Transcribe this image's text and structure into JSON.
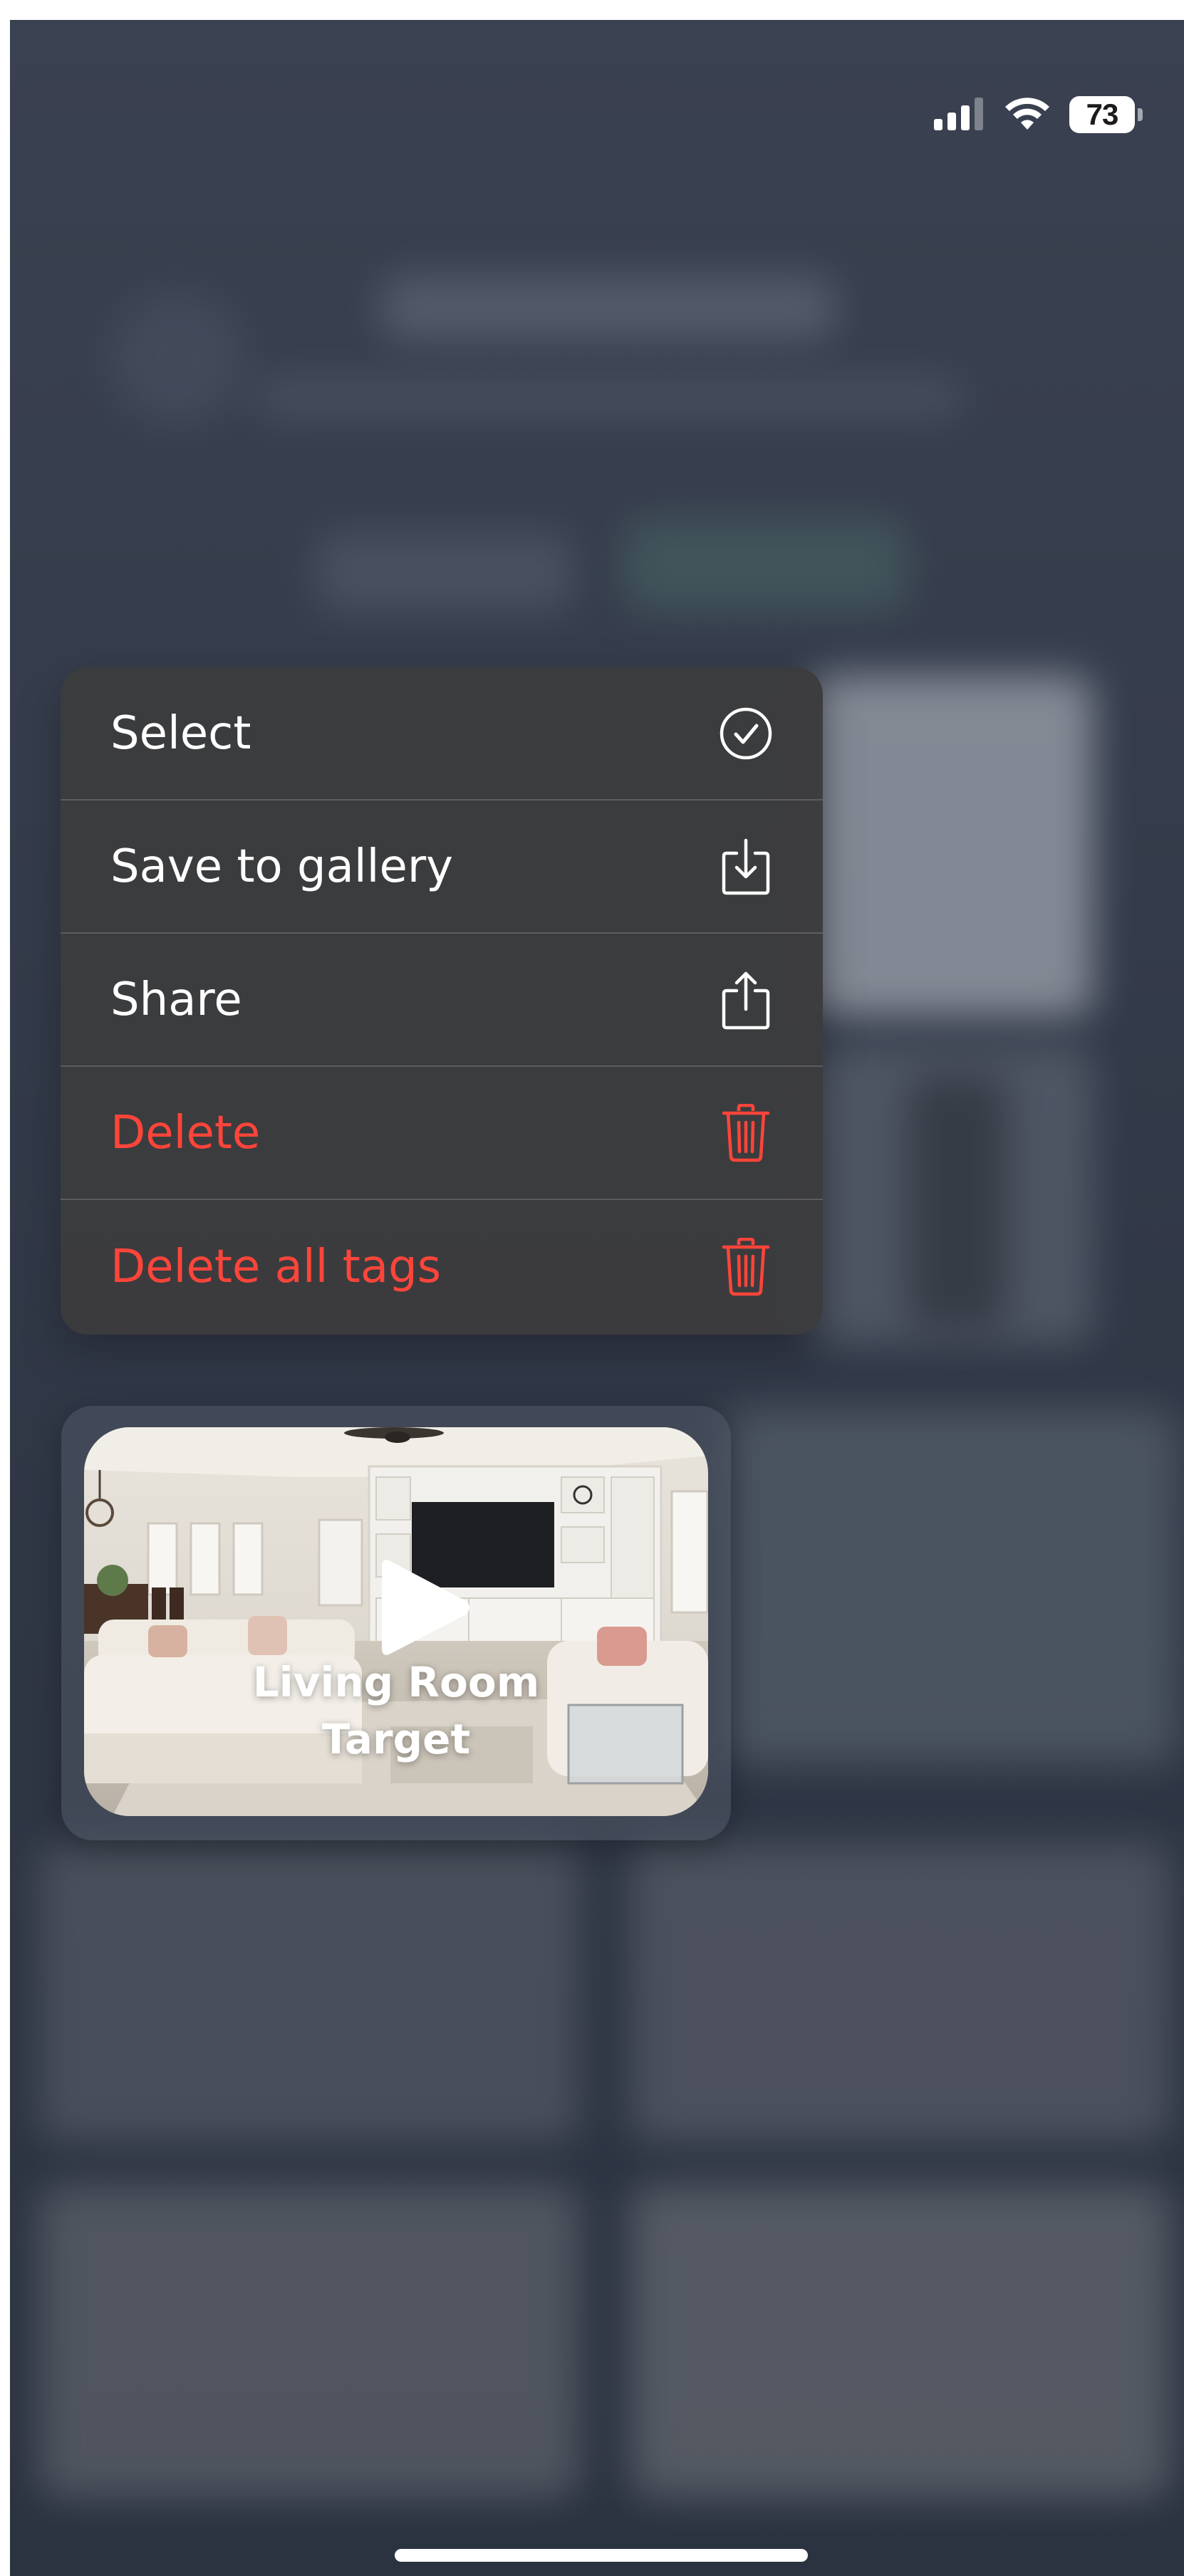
{
  "status_bar": {
    "battery_level": "73",
    "signal_icon": "cellular-signal-icon",
    "wifi_icon": "wifi-icon"
  },
  "context_menu": {
    "items": [
      {
        "label": "Select",
        "icon": "checkmark-circle-icon",
        "destructive": false
      },
      {
        "label": "Save to gallery",
        "icon": "download-tray-icon",
        "destructive": false
      },
      {
        "label": "Share",
        "icon": "share-icon",
        "destructive": false
      },
      {
        "label": "Delete",
        "icon": "trash-icon",
        "destructive": true
      },
      {
        "label": "Delete all tags",
        "icon": "trash-icon",
        "destructive": true
      }
    ]
  },
  "preview": {
    "title_line1": "Living Room",
    "title_line2": "Target",
    "play_icon": "play-icon"
  },
  "colors": {
    "destructive": "#ff453a",
    "menu_background": "#3c3c3e",
    "text": "#ffffff"
  }
}
